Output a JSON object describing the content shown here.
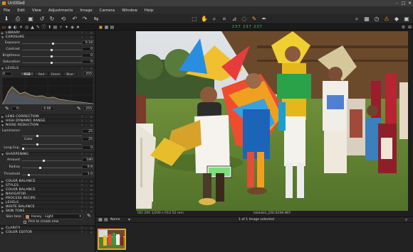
{
  "window": {
    "title": "Untitled"
  },
  "menu": [
    "File",
    "Edit",
    "View",
    "Adjustments",
    "Image",
    "Camera",
    "Window",
    "Help"
  ],
  "toolstrip": {
    "rgb_r": "237",
    "rgb_g": "237",
    "rgb_b": "237"
  },
  "panel": {
    "library": "LIBRARY",
    "exposure": {
      "title": "EXPOSURE",
      "rows": [
        {
          "label": "Exposure",
          "value": "0.18",
          "knob": 0.53
        },
        {
          "label": "Contrast",
          "value": "0",
          "knob": 0.5
        },
        {
          "label": "Brightness",
          "value": "0",
          "knob": 0.5
        },
        {
          "label": "Saturation",
          "value": "0",
          "knob": 0.5
        }
      ]
    },
    "levels": {
      "title": "LEVELS",
      "in_low": "0",
      "in_high": "255",
      "tabs": [
        "RGB",
        "Red",
        "Green",
        "Blue"
      ],
      "out_low": "0",
      "mid": "0.00",
      "out_high": "255"
    },
    "sections_a": [
      "LENS CORRECTION",
      "HIGH DYNAMIC RANGE",
      "NOISE REDUCTION"
    ],
    "noise": {
      "rows": [
        {
          "label": "Luminance",
          "value": "25",
          "knob": 0.25
        },
        {
          "label": "Color",
          "value": "25",
          "knob": 0.25
        },
        {
          "label": "Long Exp.",
          "value": "0",
          "knob": 0.0
        }
      ]
    },
    "sharpening": {
      "title": "SHARPENING",
      "rows": [
        {
          "label": "Amount",
          "value": "180",
          "knob": 0.36
        },
        {
          "label": "Radius",
          "value": "0.8",
          "knob": 0.3
        },
        {
          "label": "Threshold",
          "value": "1.0",
          "knob": 0.1
        }
      ]
    },
    "sections_b": [
      "COLOR BALANCE",
      "STYLES",
      "COLOR BALANCE",
      "NAVIGATOR",
      "PROCESS RECIPE",
      "LEVELS",
      "WHITE BALANCE",
      "SKIN TONE"
    ],
    "skin_tone": {
      "label": "Skin tone",
      "preset": "Honey - Light",
      "pick_label": "Pick to create new"
    },
    "sections_c": [
      "CLARITY",
      "COLOR EDITOR"
    ]
  },
  "viewer": {
    "meta_left": "ISO 200  1/200 s  f/10  52 mm",
    "filename": "kkkkkkk_DSC0298.NEF"
  },
  "filmstrip": {
    "sort_label": "Name",
    "count": "1 of 1 Image selected"
  }
}
